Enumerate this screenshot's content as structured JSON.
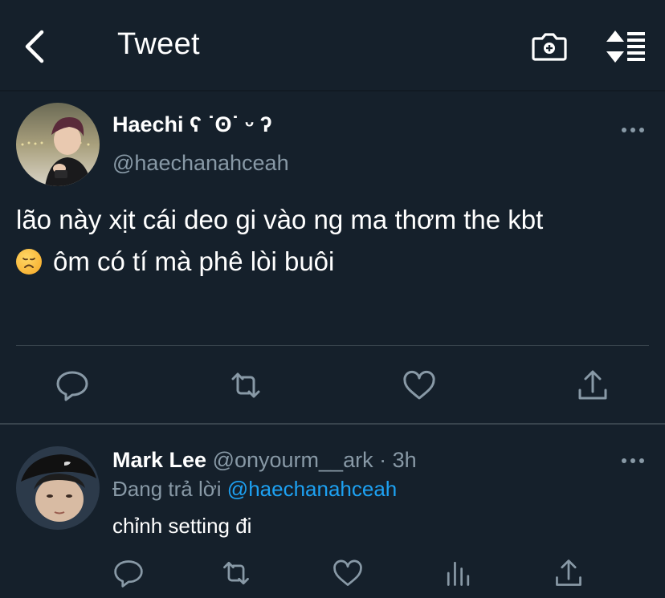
{
  "header": {
    "title": "Tweet",
    "back_icon": "chevron-left-icon",
    "camera_icon": "camera-add-icon",
    "sort_icon": "sparkle-sort-icon"
  },
  "colors": {
    "background": "#15202b",
    "text_primary": "#ffffff",
    "text_secondary": "#8899a6",
    "accent": "#1da1f2",
    "divider": "#38444d"
  },
  "main_tweet": {
    "author": {
      "display_name": "Haechi ʕ ˙ʘ˙ ᵕ ʔ",
      "handle": "@haechanahceah"
    },
    "text_line1": "lão này xịt cái deo gi vào ng ma thơm the kbt",
    "text_line2": "ôm có tí mà phê lòi buôi",
    "emoji": "disappointed-face-emoji",
    "actions": [
      "reply-icon",
      "retweet-icon",
      "like-icon",
      "share-icon"
    ]
  },
  "reply": {
    "author": {
      "display_name": "Mark Lee",
      "handle": "@onyourm__ark",
      "separator": "·",
      "time": "3h"
    },
    "replying_label": "Đang trả lời",
    "replying_to": "@haechanahceah",
    "text": "chỉnh setting đi",
    "actions": [
      "reply-icon",
      "retweet-icon",
      "like-icon",
      "analytics-icon",
      "share-icon"
    ]
  }
}
